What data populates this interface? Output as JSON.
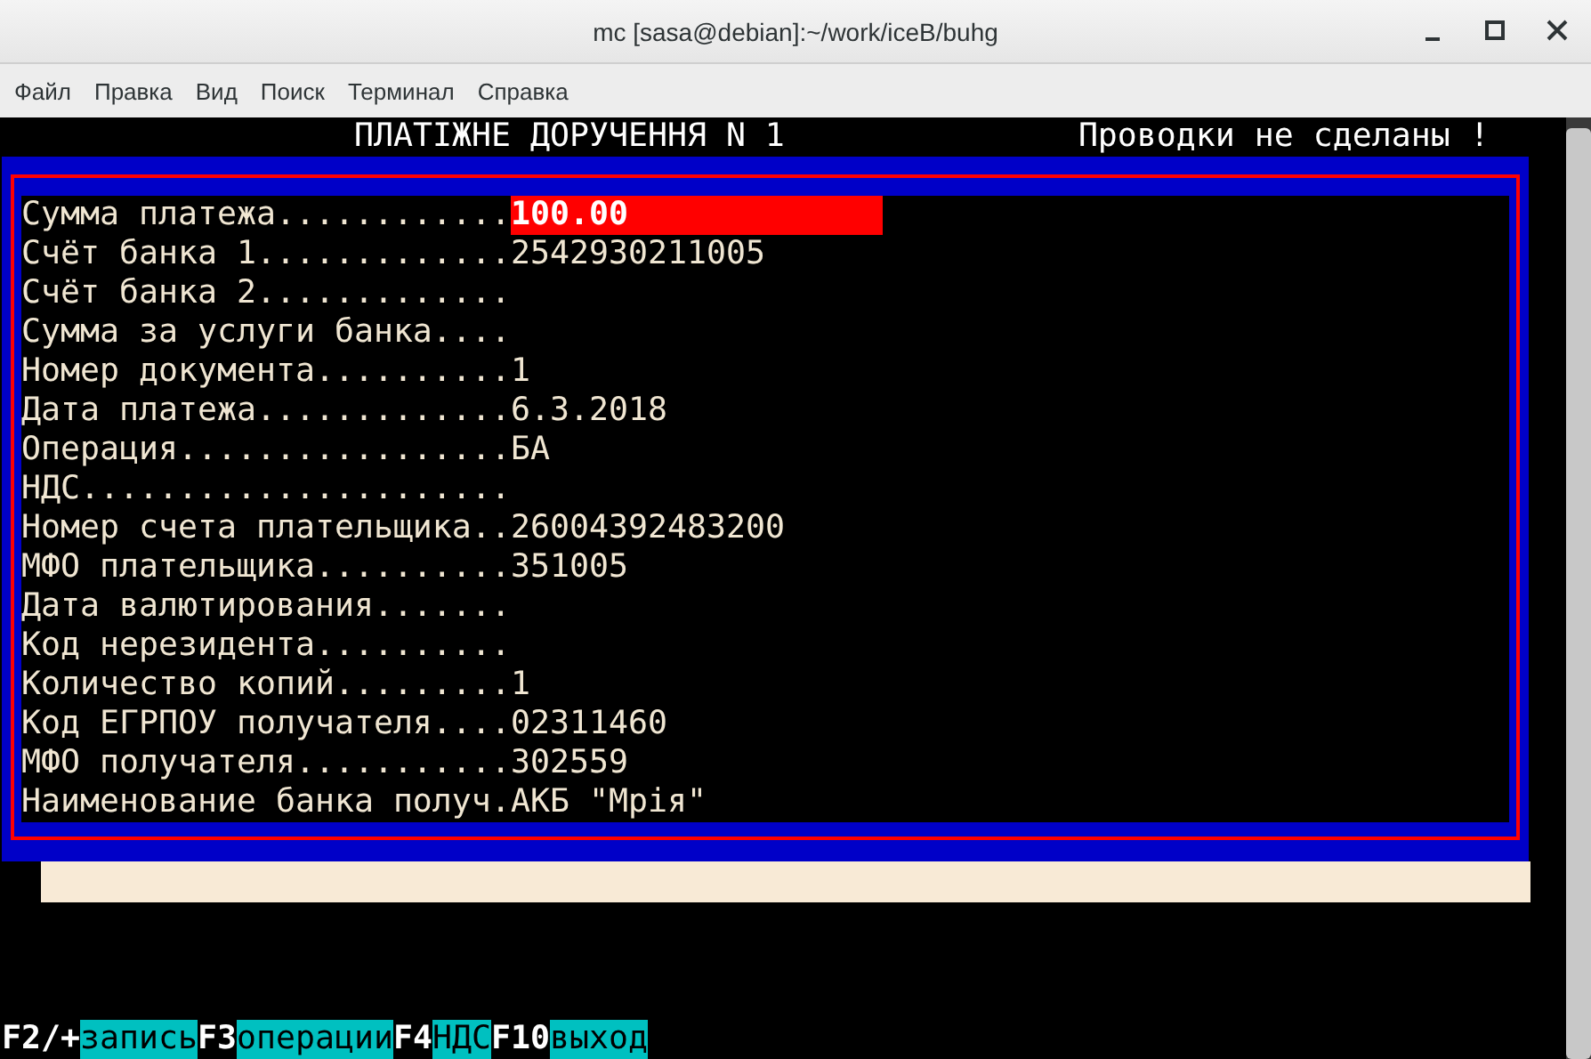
{
  "window": {
    "title": "mc [sasa@debian]:~/work/iceB/buhg"
  },
  "menu": [
    "Файл",
    "Правка",
    "Вид",
    "Поиск",
    "Терминал",
    "Справка"
  ],
  "header": {
    "title": "ПЛАТІЖНЕ ДОРУЧЕННЯ N 1",
    "status": "Проводки не сделаны !"
  },
  "fields": [
    {
      "label": "Сумма платежа............",
      "value": "100.00",
      "selected": true
    },
    {
      "label": "Счёт банка 1.............",
      "value": "2542930211005",
      "selected": false
    },
    {
      "label": "Счёт банка 2.............",
      "selected": false
    },
    {
      "label": "Сумма за услуги банка....",
      "selected": false
    },
    {
      "label": "Номер документа..........",
      "value": "1",
      "selected": false
    },
    {
      "label": "Дата платежа.............",
      "value": "6.3.2018",
      "selected": false
    },
    {
      "label": "Операция.................",
      "value": "БА",
      "selected": false
    },
    {
      "label": "НДС......................",
      "selected": false
    },
    {
      "label": "Номер счета плательщика..",
      "value": "26004392483200",
      "selected": false
    },
    {
      "label": "МФО плательщика..........",
      "value": "351005",
      "selected": false
    },
    {
      "label": "Дата валютирования.......",
      "selected": false
    },
    {
      "label": "Код нерезидента..........",
      "selected": false
    },
    {
      "label": "Количество копий.........",
      "value": "1",
      "selected": false
    },
    {
      "label": "Код ЕГРПОУ получателя....",
      "value": "02311460",
      "selected": false
    },
    {
      "label": "МФО получателя...........",
      "value": "302559",
      "selected": false
    },
    {
      "label": "Наименование банка получ.",
      "value": "АКБ \"Мрія\"",
      "selected": false
    }
  ],
  "keys": [
    {
      "key": "F2/+",
      "action": "запись"
    },
    {
      "key": "F3",
      "action": "операции"
    },
    {
      "key": "F4",
      "action": "НДС"
    },
    {
      "key": "F10",
      "action": "выход"
    }
  ]
}
